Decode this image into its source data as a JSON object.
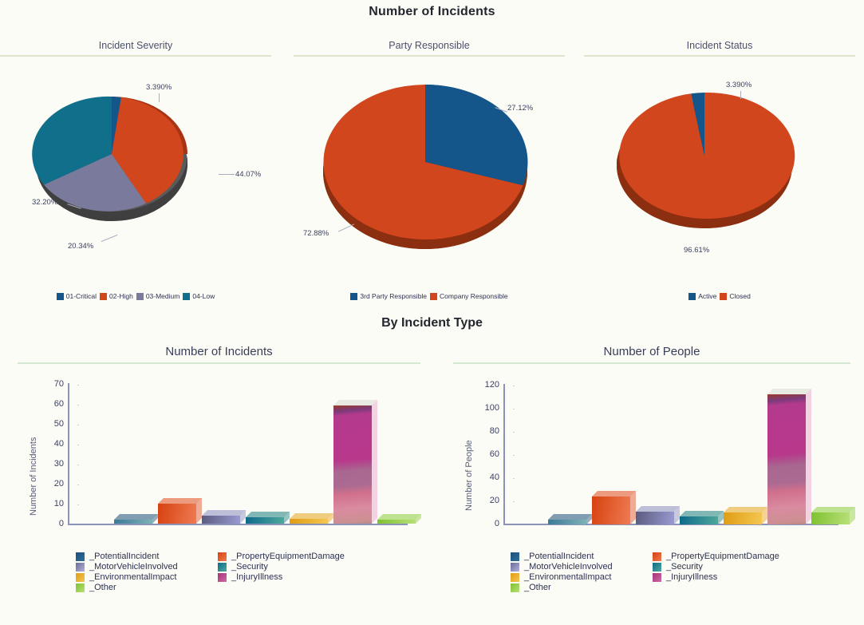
{
  "header": {
    "main_title": "Number of Incidents",
    "section_title": "By Incident Type"
  },
  "panels": {
    "incident_severity": {
      "title": "Incident Severity"
    },
    "party_responsible": {
      "title": "Party Responsible"
    },
    "incident_status": {
      "title": "Incident Status"
    },
    "incidents_by_type": {
      "title": "Number of Incidents"
    },
    "people_by_type": {
      "title": "Number of People"
    }
  },
  "colors": {
    "critical_blue": "#14558a",
    "high_orange": "#d2461e",
    "medium_purple": "#7a7a9c",
    "low_teal": "#10708c",
    "potential_incident": "#1e4f7a",
    "property_damage": "#e04a1e",
    "motor_vehicle": "#8b8cc0",
    "security": "#1d8080",
    "environmental": "#e8a41c",
    "injury_illness": "#c03a8a",
    "other": "#8ccc3c",
    "axis": "#8d92b8",
    "title": "#4c4f6b",
    "rule": "#e2e3cd",
    "rule_green": "#d6e8d2",
    "background": "#fbfcf6"
  },
  "chart_data": [
    {
      "type": "pie",
      "title": "Incident Severity",
      "labels": [
        "01-Critical",
        "02-High",
        "03-Medium",
        "04-Low"
      ],
      "values": [
        3.39,
        44.07,
        20.34,
        32.2
      ],
      "value_labels": [
        "3.390%",
        "44.07%",
        "20.34%",
        "32.20%"
      ],
      "colors": [
        "#14558a",
        "#d2461e",
        "#7a7a9c",
        "#10708c"
      ],
      "legend_position": "bottom",
      "three_d": true
    },
    {
      "type": "pie",
      "title": "Party Responsible",
      "labels": [
        "3rd Party Responsible",
        "Company Responsible"
      ],
      "values": [
        27.12,
        72.88
      ],
      "value_labels": [
        "27.12%",
        "72.88%"
      ],
      "colors": [
        "#14558a",
        "#d2461e"
      ],
      "legend_position": "bottom",
      "three_d": true
    },
    {
      "type": "pie",
      "title": "Incident Status",
      "labels": [
        "Active",
        "Closed"
      ],
      "values": [
        3.39,
        96.61
      ],
      "value_labels": [
        "3.390%",
        "96.61%"
      ],
      "colors": [
        "#14558a",
        "#d2461e"
      ],
      "legend_position": "bottom",
      "three_d": true
    },
    {
      "type": "bar",
      "title": "Number of Incidents",
      "xlabel": "",
      "ylabel": "Number of Incidents",
      "ylim": [
        0,
        70
      ],
      "yticks": [
        0,
        10,
        20,
        30,
        40,
        50,
        60,
        70
      ],
      "categories": [
        "_PotentialIncident",
        "_PropertyEquipmentDamage",
        "_MotorVehicleInvolved",
        "_Security",
        "_EnvironmentalImpact",
        "_InjuryIllness",
        "_Other"
      ],
      "values": [
        2,
        10,
        4,
        3,
        2,
        59,
        2
      ],
      "colors": [
        "#1e4f7a",
        "#e04a1e",
        "#8b8cc0",
        "#1d8080",
        "#e8a41c",
        "#c03a8a",
        "#8ccc3c"
      ],
      "grid": false,
      "legend_position": "bottom",
      "three_d": true
    },
    {
      "type": "bar",
      "title": "Number of People",
      "xlabel": "",
      "ylabel": "Number of People",
      "ylim": [
        0,
        120
      ],
      "yticks": [
        0,
        20,
        40,
        60,
        80,
        100,
        120
      ],
      "categories": [
        "_PotentialIncident",
        "_PropertyEquipmentDamage",
        "_MotorVehicleInvolved",
        "_Security",
        "_EnvironmentalImpact",
        "_InjuryIllness",
        "_Other"
      ],
      "values": [
        4,
        24,
        11,
        7,
        10,
        112,
        10
      ],
      "colors": [
        "#1e4f7a",
        "#e04a1e",
        "#8b8cc0",
        "#1d8080",
        "#e8a41c",
        "#c03a8a",
        "#8ccc3c"
      ],
      "grid": false,
      "legend_position": "bottom",
      "three_d": true
    }
  ],
  "pie_legends": {
    "severity": [
      {
        "label": "01-Critical",
        "color": "#14558a"
      },
      {
        "label": "02-High",
        "color": "#d2461e"
      },
      {
        "label": "03-Medium",
        "color": "#7a7a9c"
      },
      {
        "label": "04-Low",
        "color": "#10708c"
      }
    ],
    "party": [
      {
        "label": "3rd Party Responsible",
        "color": "#14558a"
      },
      {
        "label": "Company Responsible",
        "color": "#d2461e"
      }
    ],
    "status": [
      {
        "label": "Active",
        "color": "#14558a"
      },
      {
        "label": "Closed",
        "color": "#d2461e"
      }
    ]
  },
  "bar_legend": [
    {
      "label": "_PotentialIncident",
      "color": "#1e4f7a"
    },
    {
      "label": "_PropertyEquipmentDamage",
      "color": "#e04a1e"
    },
    {
      "label": "_MotorVehicleInvolved",
      "color": "#8b8cc0"
    },
    {
      "label": "_Security",
      "color": "#1d8080"
    },
    {
      "label": "_EnvironmentalImpact",
      "color": "#e8a41c"
    },
    {
      "label": "_InjuryIllness",
      "color": "#c03a8a"
    },
    {
      "label": "_Other",
      "color": "#8ccc3c"
    }
  ]
}
